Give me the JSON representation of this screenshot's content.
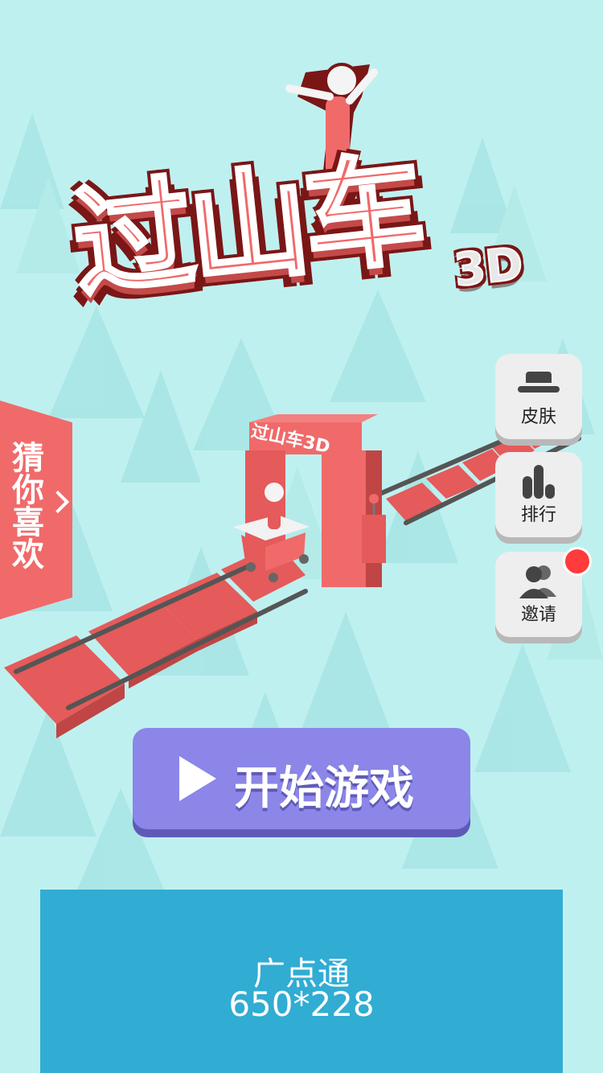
{
  "game": {
    "title": "过山车",
    "title_suffix": "3D",
    "gate_sign": "过山车3D"
  },
  "side_tab": {
    "label": "猜你喜欢"
  },
  "right_menu": {
    "skin_label": "皮肤",
    "rank_label": "排行",
    "invite_label": "邀请",
    "skin_icon": "hat-icon",
    "rank_icon": "bar-chart-icon",
    "invite_icon": "users-icon"
  },
  "start_button": {
    "label": "开始游戏",
    "icon": "play-icon"
  },
  "ad": {
    "line1": "广点通",
    "line2": "650*228"
  },
  "colors": {
    "background": "#bff0f0",
    "brand_red": "#f06a6a",
    "dark_red": "#7a1616",
    "start_purple": "#8b86e8",
    "ad_blue": "#31acd3",
    "notification": "#ff3b3b"
  }
}
